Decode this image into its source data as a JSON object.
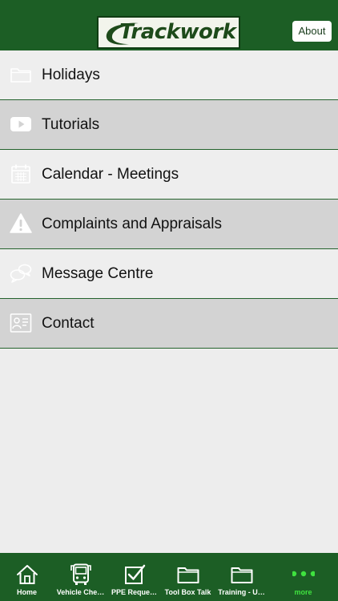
{
  "header": {
    "logo_text": "Trackwork",
    "about_label": "About"
  },
  "menu": {
    "items": [
      {
        "label": "Holidays",
        "icon": "folder-icon"
      },
      {
        "label": "Tutorials",
        "icon": "youtube-play-icon"
      },
      {
        "label": "Calendar - Meetings",
        "icon": "calendar-icon"
      },
      {
        "label": "Complaints and Appraisals",
        "icon": "warning-icon"
      },
      {
        "label": "Message Centre",
        "icon": "chat-bubbles-icon"
      },
      {
        "label": "Contact",
        "icon": "contact-card-icon"
      }
    ]
  },
  "tabbar": {
    "tabs": [
      {
        "label": "Home",
        "icon": "home-icon"
      },
      {
        "label": "Vehicle Che…",
        "icon": "bus-icon"
      },
      {
        "label": "PPE Reque…",
        "icon": "checkbox-icon"
      },
      {
        "label": "Tool Box Talk",
        "icon": "folder-icon"
      },
      {
        "label": "Training - U…",
        "icon": "folder-icon"
      },
      {
        "label": "more",
        "icon": "more-dots-icon"
      }
    ]
  },
  "colors": {
    "brand_green": "#1c5e25",
    "active_tab_green": "#3fe23f",
    "row_light": "#eeeeee",
    "row_dark": "#d3d3d3",
    "background": "#ededed"
  }
}
